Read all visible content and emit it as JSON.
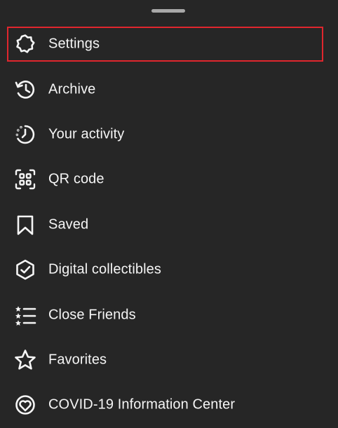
{
  "menu": {
    "items": [
      {
        "label": "Settings",
        "icon": "settings-gear-icon",
        "highlighted": true
      },
      {
        "label": "Archive",
        "icon": "archive-history-icon"
      },
      {
        "label": "Your activity",
        "icon": "activity-clock-icon"
      },
      {
        "label": "QR code",
        "icon": "qr-code-icon"
      },
      {
        "label": "Saved",
        "icon": "bookmark-icon"
      },
      {
        "label": "Digital collectibles",
        "icon": "shield-check-icon"
      },
      {
        "label": "Close Friends",
        "icon": "star-list-icon"
      },
      {
        "label": "Favorites",
        "icon": "star-icon"
      },
      {
        "label": "COVID-19 Information Center",
        "icon": "heart-circle-icon"
      }
    ]
  },
  "colors": {
    "background": "#262626",
    "text": "#f5f5f5",
    "highlight_border": "#e0262e",
    "handle": "#a8a8a8"
  }
}
